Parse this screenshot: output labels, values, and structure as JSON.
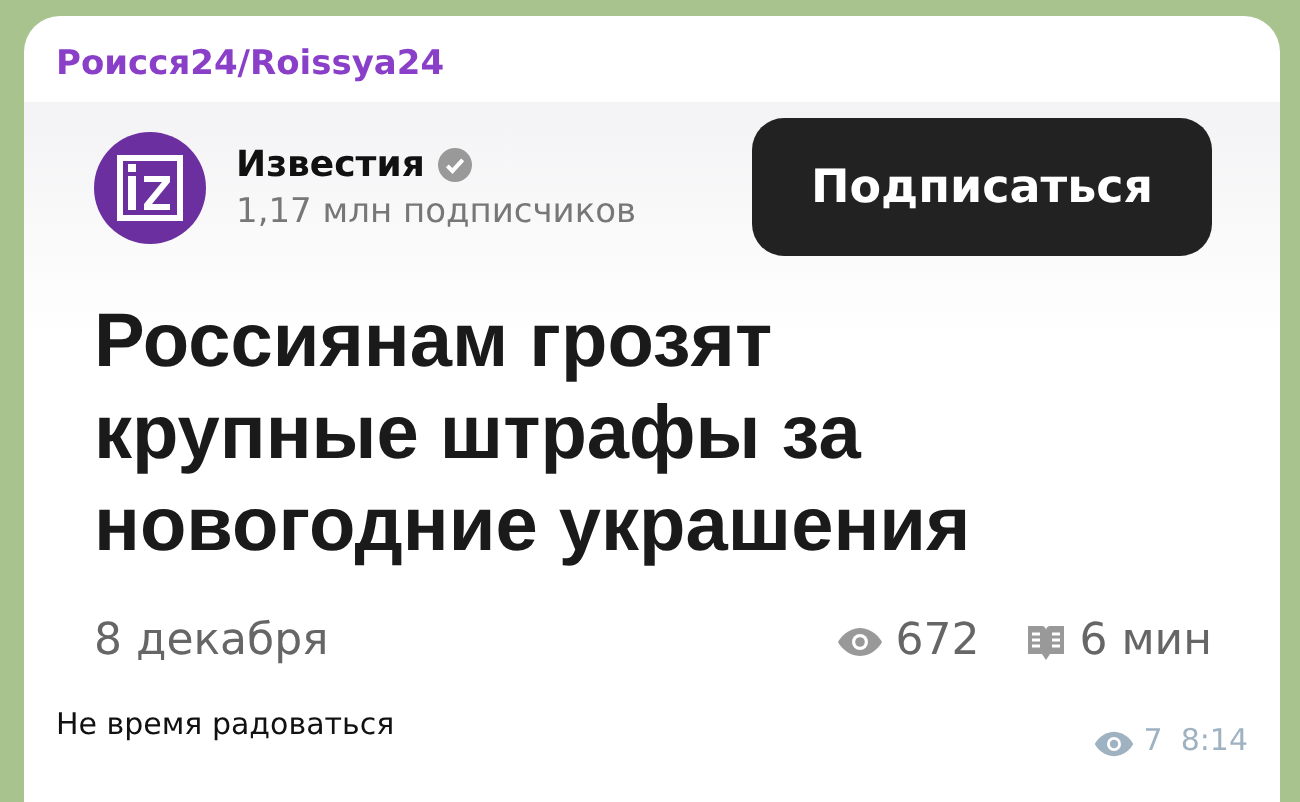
{
  "message": {
    "sender": "Роисся24/Roissya24",
    "preview": {
      "channel": {
        "name": "Известия",
        "verified": true,
        "subscribers": "1,17 млн подписчиков"
      },
      "subscribe_button": "Подписаться",
      "headline": "Россиянам грозят крупные штрафы за новогодние украшения",
      "date": "8 декабря",
      "views": "672",
      "read_time": "6 мин"
    },
    "caption": "Не время радоваться",
    "views": "7",
    "time": "8:14"
  }
}
